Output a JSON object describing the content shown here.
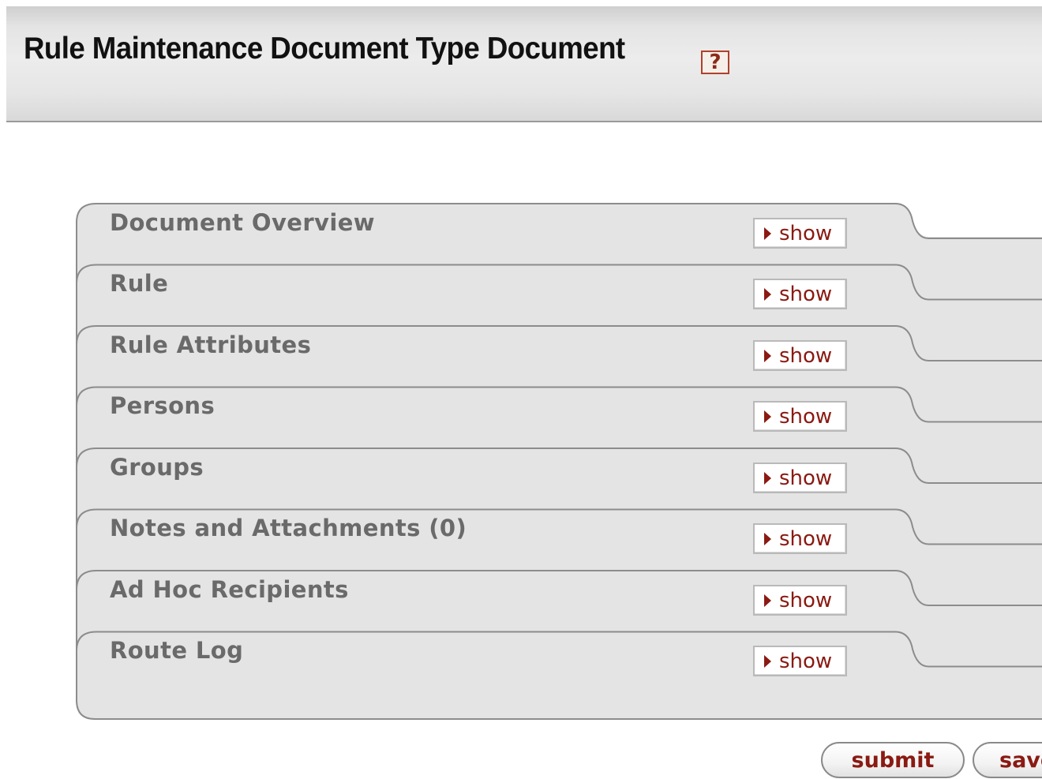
{
  "header": {
    "title": "Rule Maintenance Document Type Document",
    "help_icon": "help-icon",
    "help_glyph": "?"
  },
  "panels": [
    {
      "label": "Document Overview",
      "toggle": "show"
    },
    {
      "label": "Rule",
      "toggle": "show"
    },
    {
      "label": "Rule Attributes",
      "toggle": "show"
    },
    {
      "label": "Persons",
      "toggle": "show"
    },
    {
      "label": "Groups",
      "toggle": "show"
    },
    {
      "label": "Notes and Attachments (0)",
      "toggle": "show"
    },
    {
      "label": "Ad Hoc Recipients",
      "toggle": "show"
    },
    {
      "label": "Route Log",
      "toggle": "show"
    }
  ],
  "actions": {
    "submit_label": "submit",
    "save_label": "save"
  },
  "colors": {
    "accent": "#8a1a12",
    "panel_bg": "#e4e4e4",
    "panel_border": "#8c8c8c",
    "label": "#6a6a6a"
  }
}
